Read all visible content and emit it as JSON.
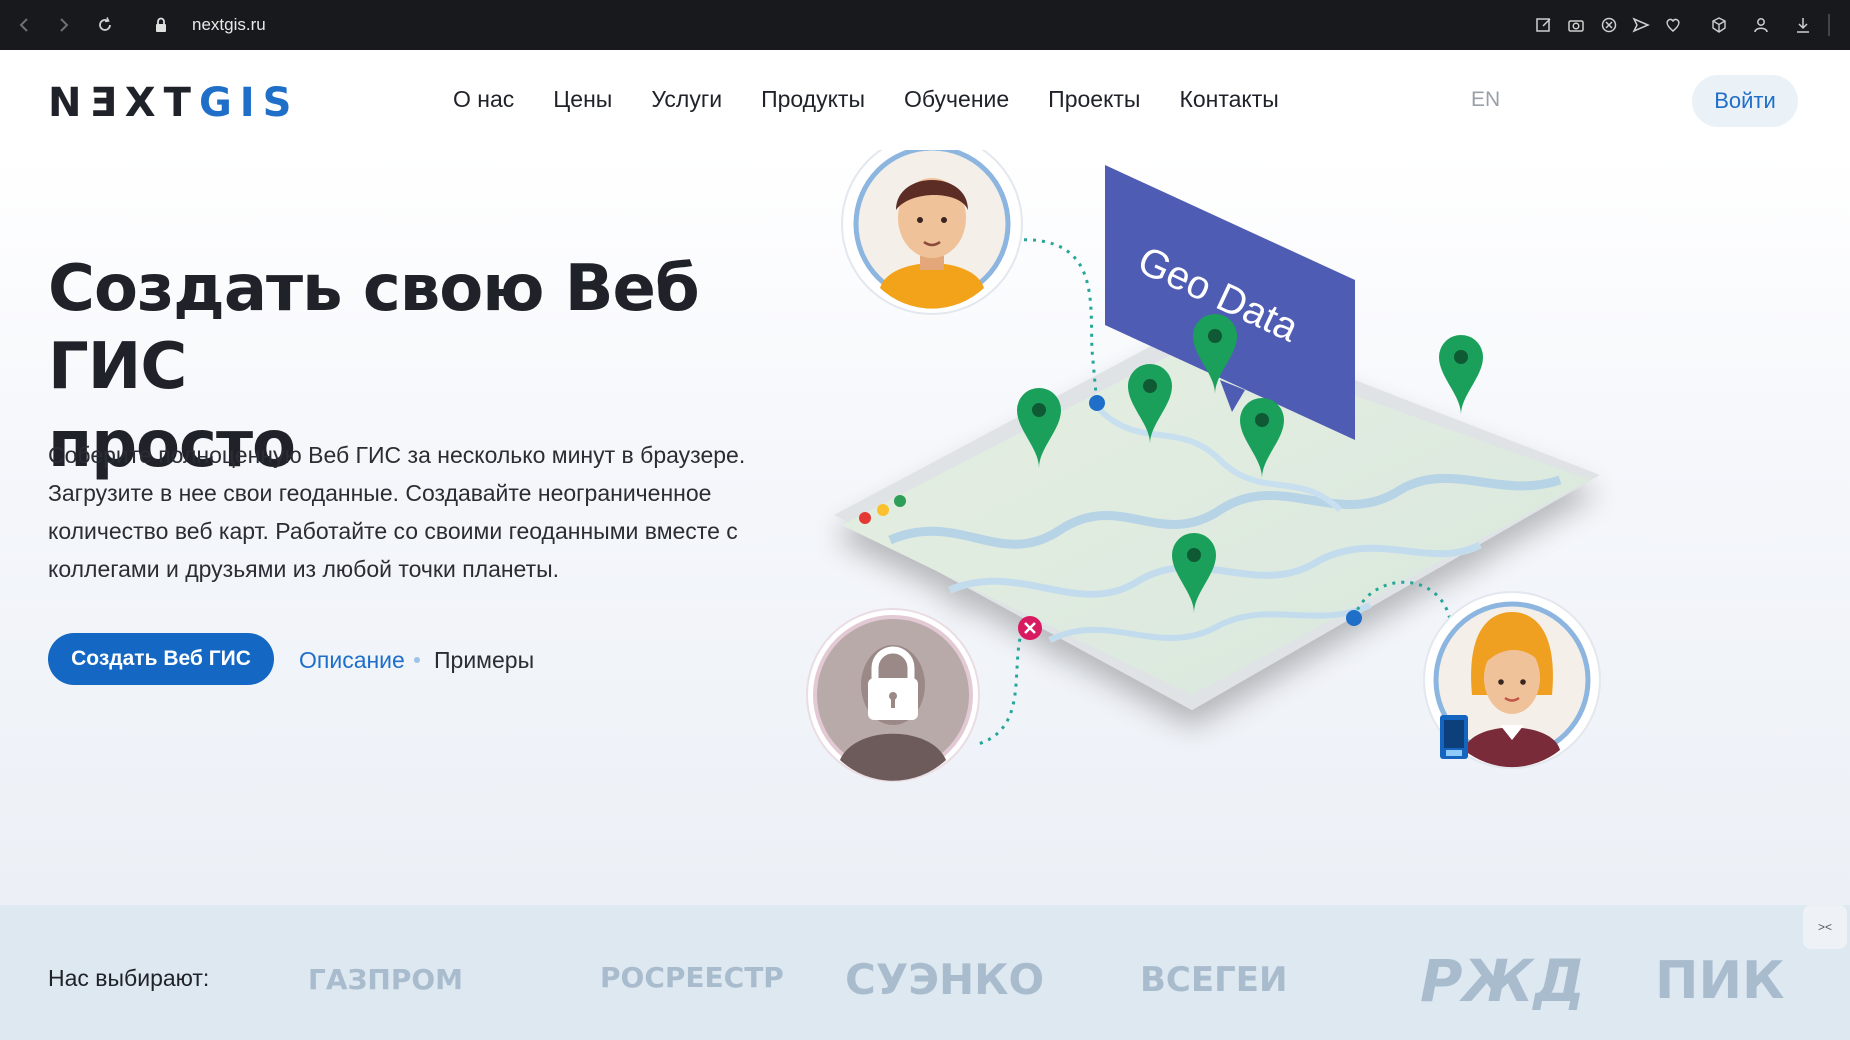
{
  "browser": {
    "url": "nextgis.ru"
  },
  "header": {
    "logo_dark": "NƎXT",
    "logo_blue": "GIS",
    "nav": [
      "О нас",
      "Цены",
      "Услуги",
      "Продукты",
      "Обучение",
      "Проекты",
      "Контакты"
    ],
    "lang": "EN",
    "login": "Войти"
  },
  "hero": {
    "title_line1": "Создать свою Веб ГИС",
    "title_line2": "просто",
    "text_lines": [
      "Соберите полноценную Веб ГИС за несколько минут в браузере.",
      "Загрузите в нее свои геоданные. Создавайте неограниченное",
      "количество веб карт. Работайте со своими геоданными вместе с",
      "коллегами и друзьями из любой точки планеты."
    ],
    "cta": "Создать Веб ГИС",
    "desc_link": "Описание",
    "examples_link": "Примеры",
    "banner_text": "Geo Data"
  },
  "clients": {
    "label": "Нас выбирают:",
    "logos": [
      "ГАЗПРОМ",
      "РОСРЕЕСТР",
      "СУЭНКО",
      "ВСЕГЕИ",
      "РЖД",
      "ПИК"
    ]
  },
  "colors": {
    "brand_blue": "#1f6fc9",
    "cta_blue": "#1467c3",
    "pin_green": "#1aa05a",
    "banner_indigo": "#4f5cb3"
  }
}
